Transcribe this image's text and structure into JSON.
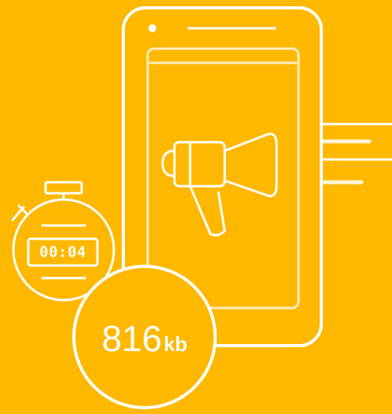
{
  "illustration": {
    "background_color": "#FFB800",
    "stroke_color": "#FFFFFF",
    "phone_icon": "phone-icon",
    "megaphone_icon": "megaphone-icon",
    "stopwatch_icon": "stopwatch-icon",
    "stopwatch": {
      "display": "00:04"
    },
    "file_size": {
      "value": "816",
      "unit": "kb"
    }
  }
}
